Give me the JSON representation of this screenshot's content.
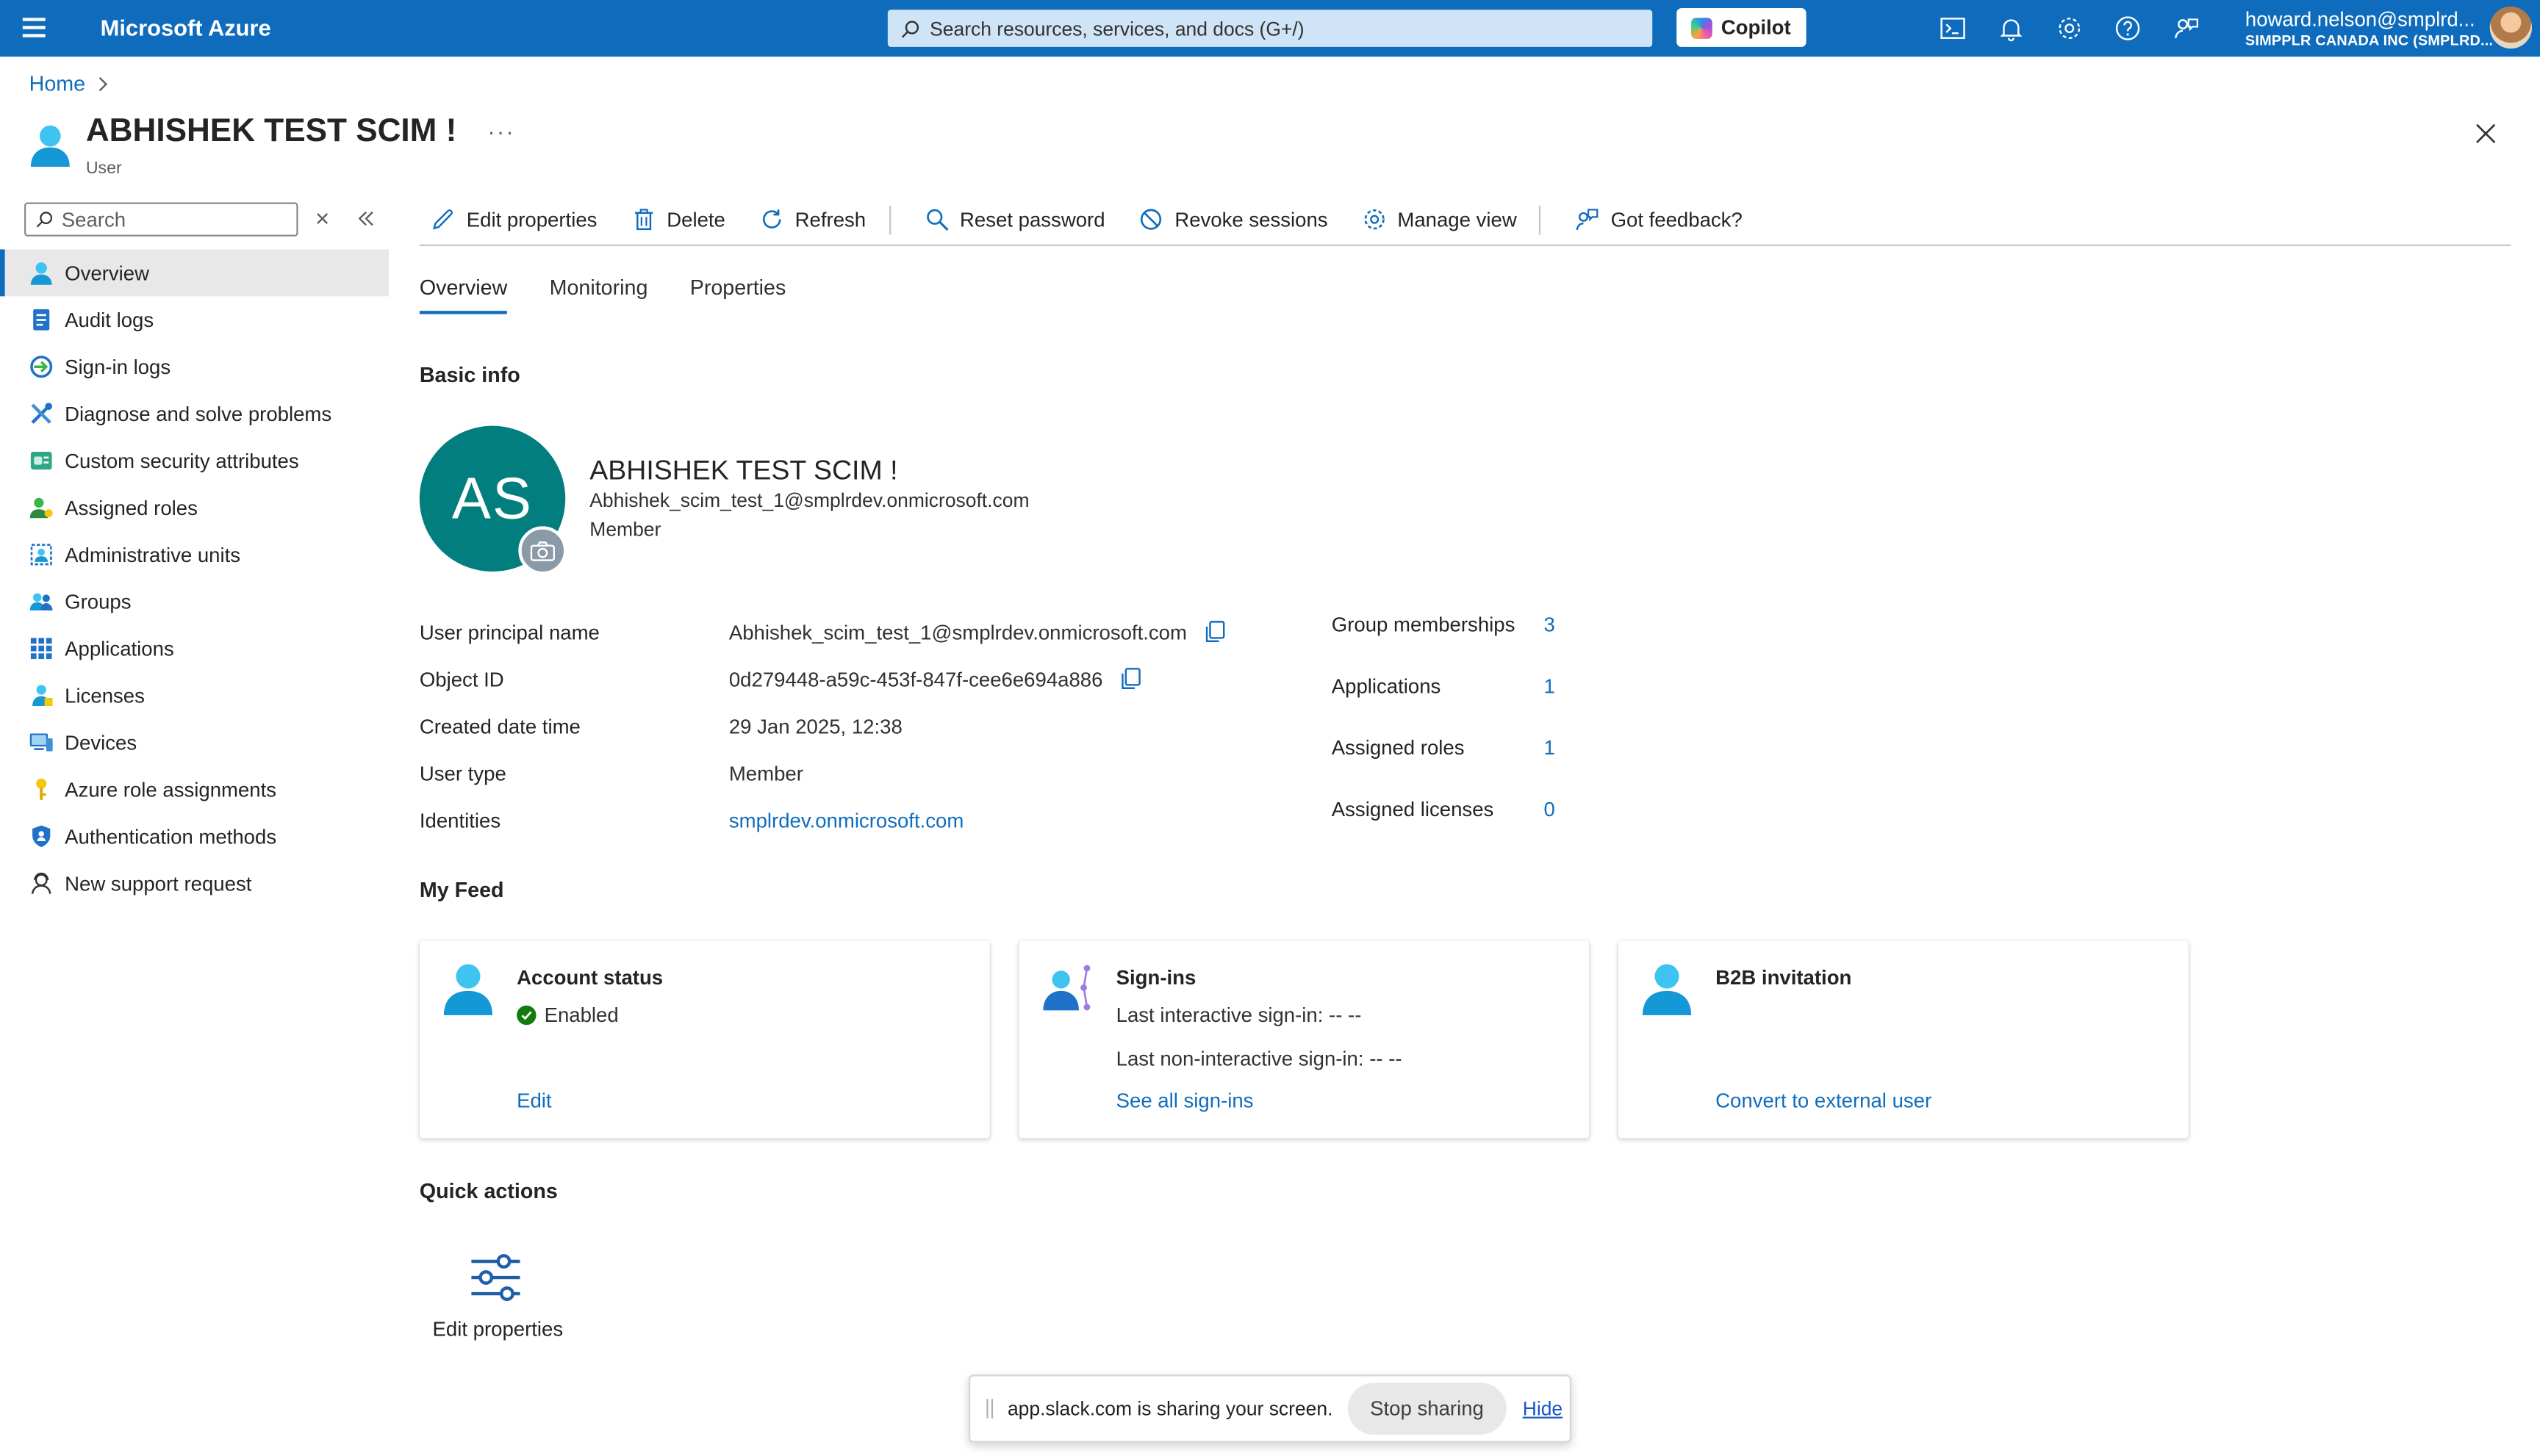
{
  "topbar": {
    "brand": "Microsoft Azure",
    "search_placeholder": "Search resources, services, and docs (G+/)",
    "copilot_label": "Copilot",
    "account_user": "howard.nelson@smplrd...",
    "account_org": "SIMPPLR CANADA INC (SMPLRD..."
  },
  "header": {
    "breadcrumb_home": "Home",
    "title": "ABHISHEK TEST SCIM !",
    "subtitle": "User",
    "more": "···"
  },
  "sidebar": {
    "search_placeholder": "Search",
    "items": [
      {
        "label": "Overview",
        "icon": "user-icon",
        "active": true
      },
      {
        "label": "Audit logs",
        "icon": "audit-icon"
      },
      {
        "label": "Sign-in logs",
        "icon": "sign-in-icon"
      },
      {
        "label": "Diagnose and solve problems",
        "icon": "wrench-icon"
      },
      {
        "label": "Custom security attributes",
        "icon": "attributes-icon"
      },
      {
        "label": "Assigned roles",
        "icon": "roles-icon"
      },
      {
        "label": "Administrative units",
        "icon": "admin-units-icon"
      },
      {
        "label": "Groups",
        "icon": "groups-icon"
      },
      {
        "label": "Applications",
        "icon": "apps-grid-icon"
      },
      {
        "label": "Licenses",
        "icon": "licenses-icon"
      },
      {
        "label": "Devices",
        "icon": "devices-icon"
      },
      {
        "label": "Azure role assignments",
        "icon": "key-icon"
      },
      {
        "label": "Authentication methods",
        "icon": "shield-icon"
      },
      {
        "label": "New support request",
        "icon": "support-icon"
      }
    ]
  },
  "toolbar": {
    "edit": "Edit properties",
    "delete": "Delete",
    "refresh": "Refresh",
    "reset_password": "Reset password",
    "revoke_sessions": "Revoke sessions",
    "manage_view": "Manage view",
    "feedback": "Got feedback?"
  },
  "tabs": [
    "Overview",
    "Monitoring",
    "Properties"
  ],
  "basic_info": {
    "section": "Basic info",
    "initials": "AS",
    "name": "ABHISHEK TEST SCIM !",
    "upn": "Abhishek_scim_test_1@smplrdev.onmicrosoft.com",
    "type": "Member"
  },
  "properties": [
    {
      "key": "User principal name",
      "value": "Abhishek_scim_test_1@smplrdev.onmicrosoft.com",
      "copy": true
    },
    {
      "key": "Object ID",
      "value": "0d279448-a59c-453f-847f-cee6e694a886",
      "copy": true
    },
    {
      "key": "Created date time",
      "value": "29 Jan 2025, 12:38"
    },
    {
      "key": "User type",
      "value": "Member"
    },
    {
      "key": "Identities",
      "value": "smplrdev.onmicrosoft.com",
      "link": true
    }
  ],
  "stats": [
    {
      "key": "Group memberships",
      "value": "3"
    },
    {
      "key": "Applications",
      "value": "1"
    },
    {
      "key": "Assigned roles",
      "value": "1"
    },
    {
      "key": "Assigned licenses",
      "value": "0"
    }
  ],
  "feed": {
    "section": "My Feed",
    "account_status": {
      "title": "Account status",
      "status": "Enabled",
      "link": "Edit"
    },
    "sign_ins": {
      "title": "Sign-ins",
      "last_interactive": "Last interactive sign-in: -- --",
      "last_non_interactive": "Last non-interactive sign-in: -- --",
      "link": "See all sign-ins"
    },
    "b2b": {
      "title": "B2B invitation",
      "link": "Convert to external user"
    }
  },
  "quick_actions": {
    "section": "Quick actions",
    "edit_label": "Edit properties"
  },
  "share_bar": {
    "text": "app.slack.com is sharing your screen.",
    "stop": "Stop sharing",
    "hide": "Hide"
  },
  "colors": {
    "azure_blue": "#0f6cbd",
    "avatar_teal": "#037e7e",
    "enabled_green": "#107c10"
  }
}
